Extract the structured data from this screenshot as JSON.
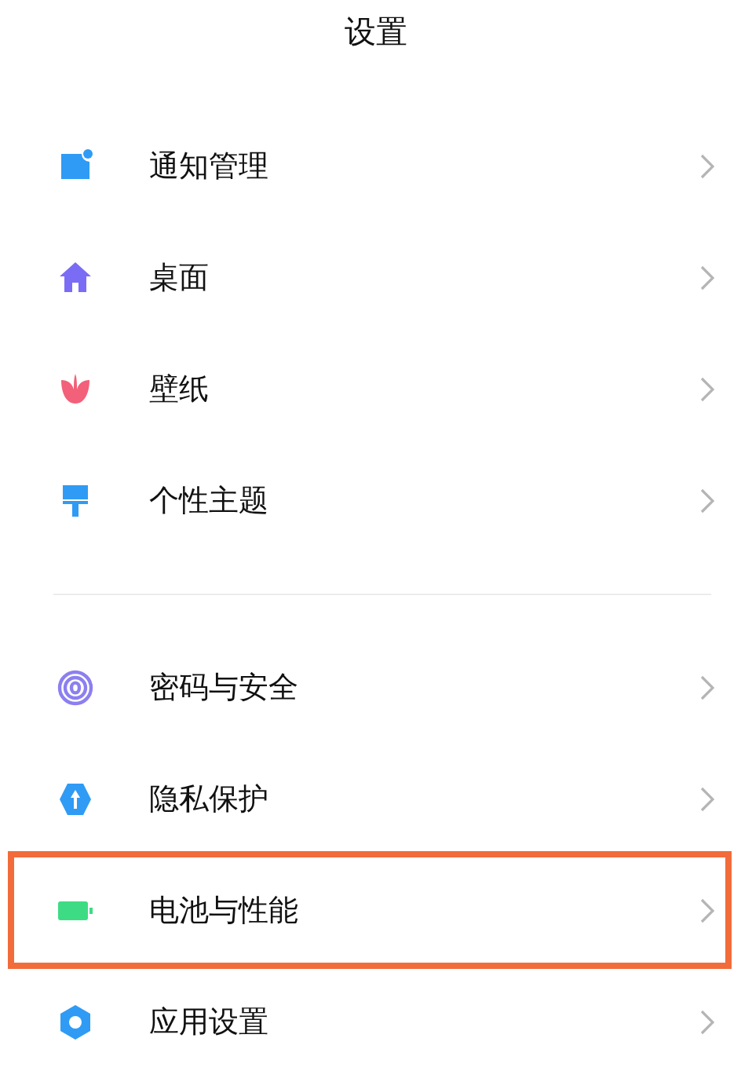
{
  "title": "设置",
  "groups": [
    {
      "items": [
        {
          "label": "通知管理",
          "highlighted": false
        },
        {
          "label": "桌面",
          "highlighted": false
        },
        {
          "label": "壁纸",
          "highlighted": false
        },
        {
          "label": "个性主题",
          "highlighted": false
        }
      ]
    },
    {
      "items": [
        {
          "label": "密码与安全",
          "highlighted": false
        },
        {
          "label": "隐私保护",
          "highlighted": false
        },
        {
          "label": "电池与性能",
          "highlighted": true
        },
        {
          "label": "应用设置",
          "highlighted": false
        }
      ]
    }
  ]
}
